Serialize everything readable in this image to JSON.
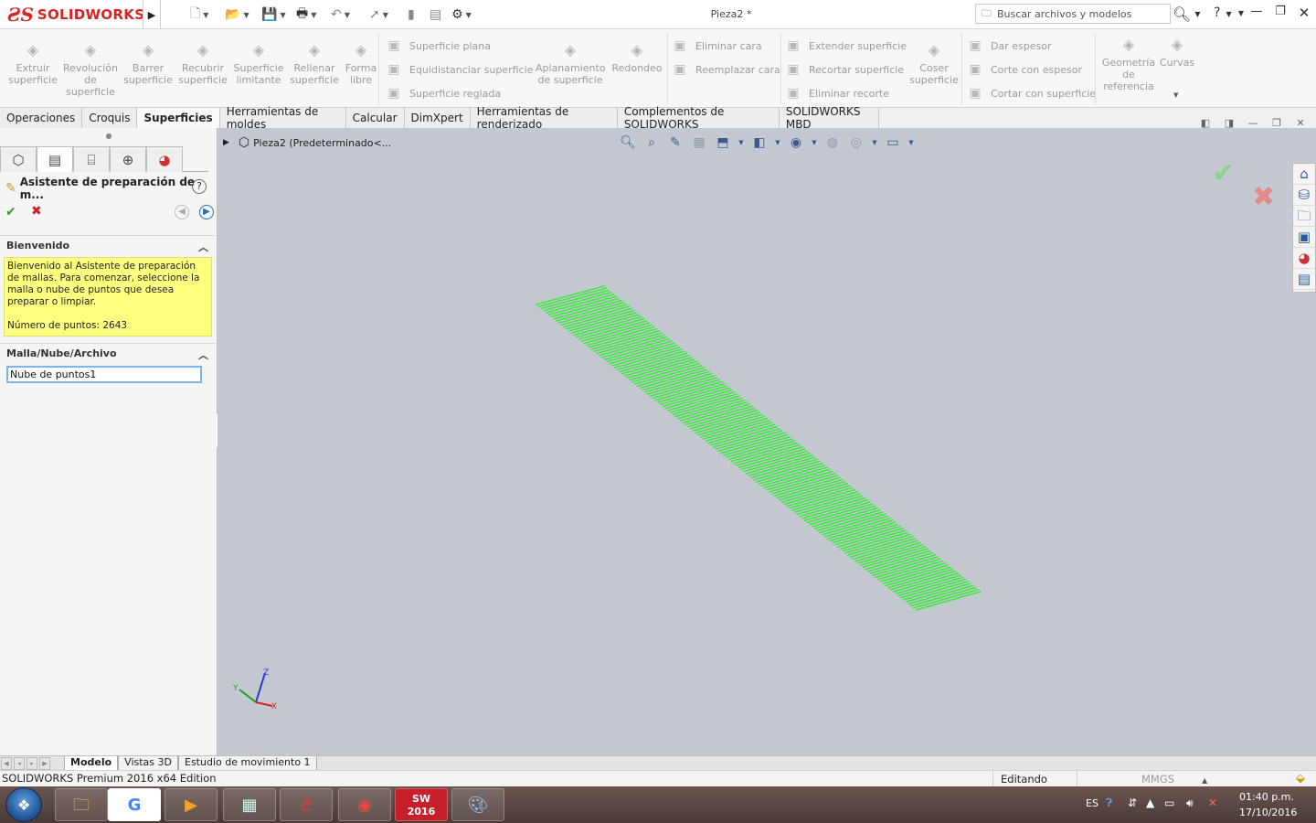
{
  "app": {
    "logo_ds": "ƧS",
    "logo_text": "SOLIDWORKS",
    "document_title": "Pieza2 *",
    "search_placeholder": "Buscar archivos y modelos",
    "help": "?"
  },
  "ribbon": {
    "tools_large": [
      {
        "label": "Extruir\nsuperficie",
        "icon": "extrude-surface-icon"
      },
      {
        "label": "Revolución\nde\nsuperficie",
        "icon": "revolve-surface-icon"
      },
      {
        "label": "Barrer\nsuperficie",
        "icon": "sweep-surface-icon"
      },
      {
        "label": "Recubrir\nsuperficie",
        "icon": "loft-surface-icon"
      },
      {
        "label": "Superficie\nlimitante",
        "icon": "boundary-surface-icon"
      },
      {
        "label": "Rellenar\nsuperficie",
        "icon": "fill-surface-icon"
      },
      {
        "label": "Forma\nlibre",
        "icon": "freeform-icon"
      }
    ],
    "group_plane": [
      "Superficie plana",
      "Equidistanciar superficie",
      "Superficie reglada"
    ],
    "tools_mid": [
      {
        "label": "Aplanamiento\nde superficie",
        "icon": "flatten-surface-icon"
      },
      {
        "label": "Redondeo",
        "icon": "fillet-icon"
      }
    ],
    "group_face": [
      "Eliminar cara",
      "Reemplazar cara"
    ],
    "group_extend": [
      "Extender superficie",
      "Recortar superficie",
      "Eliminar recorte"
    ],
    "tool_knit": {
      "label": "Coser\nsuperficie",
      "icon": "knit-surface-icon"
    },
    "group_thicken": [
      "Dar espesor",
      "Corte con espesor",
      "Cortar con superficie"
    ],
    "tool_refgeo": {
      "label": "Geometría\nde\nreferencia",
      "icon": "reference-geometry-icon"
    },
    "tool_curves": {
      "label": "Curvas",
      "icon": "curves-icon"
    }
  },
  "command_tabs": [
    "Operaciones",
    "Croquis",
    "Superficies",
    "Herramientas de moldes",
    "Calcular",
    "DimXpert",
    "Herramientas de renderizado",
    "Complementos de SOLIDWORKS",
    "SOLIDWORKS MBD"
  ],
  "active_command_tab": "Superficies",
  "property_manager": {
    "title": "Asistente de preparación de m...",
    "welcome_header": "Bienvenido",
    "welcome_text": "Bienvenido al Asistente de preparación de mallas. Para comenzar, seleccione la malla o nube de puntos que desea preparar o limpiar.",
    "points_label": "Número de puntos: 2643",
    "mesh_header": "Malla/Nube/Archivo",
    "mesh_selection": "Nube de puntos1"
  },
  "viewport": {
    "tree_item": "Pieza2  (Predeterminado<...",
    "point_color": "#22ee22",
    "background": "#c4c8d0"
  },
  "triad": {
    "x": "X",
    "y": "Y",
    "z": "Z"
  },
  "model_tabs": [
    "Modelo",
    "Vistas 3D",
    "Estudio de movimiento 1"
  ],
  "active_model_tab": "Modelo",
  "status": {
    "edition": "SOLIDWORKS Premium 2016 x64 Edition",
    "mode": "Editando Pieza",
    "units": "MMGS"
  },
  "taskbar": {
    "lang": "ES",
    "time": "01:40 p.m.",
    "date": "17/10/2016",
    "sw_badge": "2016"
  }
}
